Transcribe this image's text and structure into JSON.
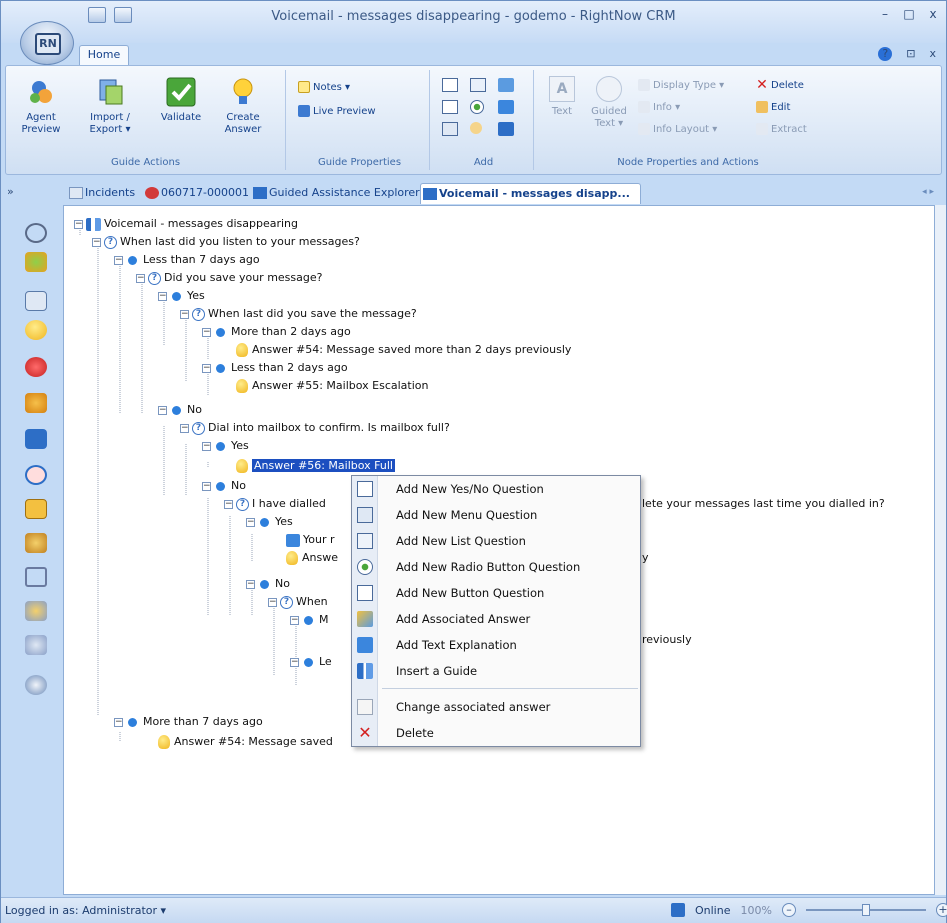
{
  "window": {
    "title": "Voicemail - messages disappearing - godemo - RightNow CRM",
    "logo_text": "RN",
    "controls": {
      "minimize": "–",
      "maximize": "□",
      "close": "x"
    }
  },
  "ribbon_tabs": {
    "home": "Home"
  },
  "ribbon_right": {
    "help": "?",
    "restore": "⊡",
    "close": "x"
  },
  "ribbon": {
    "guide_actions": {
      "label": "Guide Actions",
      "agent_preview": "Agent Preview",
      "import_export": "Import / Export ▾",
      "validate": "Validate",
      "create_answer": "Create Answer"
    },
    "guide_properties": {
      "label": "Guide Properties",
      "notes": "Notes ▾",
      "live_preview": "Live Preview"
    },
    "add": {
      "label": "Add"
    },
    "node_properties": {
      "label": "Node Properties and Actions",
      "text": "Text",
      "guided_text": "Guided Text ▾",
      "display_type": "Display Type ▾",
      "info": "Info ▾",
      "info_layout": "Info Layout ▾",
      "delete": "Delete",
      "edit": "Edit",
      "extract": "Extract"
    }
  },
  "doc_tabs": {
    "chevron": "»",
    "tabs": [
      {
        "label": "Incidents"
      },
      {
        "label": "060717-000001"
      },
      {
        "label": "Guided Assistance Explorer"
      },
      {
        "label": "Voicemail - messages disapp..."
      }
    ],
    "nav": "◂ ▸"
  },
  "tree": [
    {
      "text": "Voicemail - messages disappearing"
    },
    {
      "text": "When last did you listen to your messages?"
    },
    {
      "text": "Less than 7 days ago"
    },
    {
      "text": "Did you save your message?"
    },
    {
      "text": "Yes"
    },
    {
      "text": "When last did you save the message?"
    },
    {
      "text": "More than 2 days ago"
    },
    {
      "text": "Answer #54: Message saved more than 2 days previously"
    },
    {
      "text": "Less than 2 days ago"
    },
    {
      "text": "Answer #55: Mailbox Escalation"
    },
    {
      "text": "No"
    },
    {
      "text": "Dial into mailbox to confirm. Is mailbox full?"
    },
    {
      "text": "Yes"
    },
    {
      "text": "Answer #56: Mailbox Full"
    },
    {
      "text": "No"
    },
    {
      "text": "I have dialled"
    },
    {
      "text": "Yes"
    },
    {
      "text": "Your r"
    },
    {
      "text": "Answe"
    },
    {
      "text": "No"
    },
    {
      "text": "When"
    },
    {
      "text": "M"
    },
    {
      "text": "Le"
    },
    {
      "text": "More than 7 days ago"
    },
    {
      "text": "Answer #54: Message saved"
    }
  ],
  "tree_tail": {
    "q15": "lete your messages last time you dialled in?",
    "a18": "y",
    "a21": "reviously"
  },
  "context_menu": {
    "items": [
      {
        "label": "Add New Yes/No Question"
      },
      {
        "label": "Add New Menu Question"
      },
      {
        "label": "Add New List Question"
      },
      {
        "label": "Add New Radio Button Question"
      },
      {
        "label": "Add New Button Question"
      },
      {
        "label": "Add Associated Answer"
      },
      {
        "label": "Add Text Explanation"
      },
      {
        "label": "Insert a Guide"
      },
      {
        "label": "Change associated answer"
      },
      {
        "label": "Delete"
      }
    ]
  },
  "status": {
    "logged_in": "Logged in as: Administrator ▾",
    "online": "Online",
    "zoom": "100%",
    "zoom_out": "–",
    "zoom_in": "+"
  }
}
